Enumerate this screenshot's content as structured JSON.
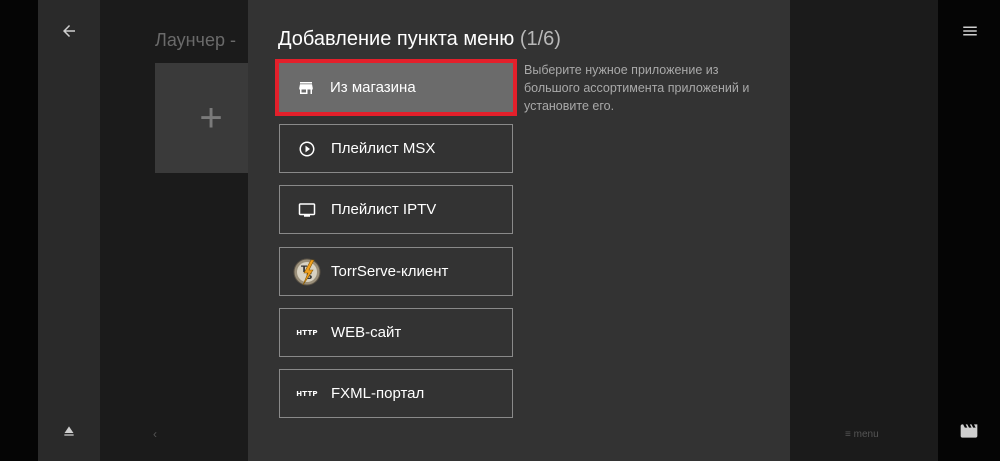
{
  "background": {
    "launcher_title": "Лаунчер -",
    "add_tile_symbol": "+",
    "page_prev_symbol": "‹",
    "menu_hint": "≡ menu"
  },
  "nav": {
    "back_icon": "arrow-left-icon",
    "menu_icon": "hamburger-icon",
    "eject_icon": "eject-icon",
    "clapper_icon": "clapperboard-icon"
  },
  "dialog": {
    "title": "Добавление пункта меню",
    "counter": "(1/6)",
    "hint": "Выберите нужное приложение из большого ассортимента приложений и установите его.",
    "items": [
      {
        "label": "Из магазина",
        "icon": "store-icon",
        "selected": true
      },
      {
        "label": "Плейлист MSX",
        "icon": "play-circle-icon",
        "selected": false
      },
      {
        "label": "Плейлист IPTV",
        "icon": "tv-icon",
        "selected": false
      },
      {
        "label": "TorrServe-клиент",
        "icon": "torrserve-logo-icon",
        "selected": false
      },
      {
        "label": "WEB-сайт",
        "icon": "http-icon",
        "icon_text": "HTTP",
        "selected": false
      },
      {
        "label": "FXML-портал",
        "icon": "http-icon",
        "icon_text": "HTTP",
        "selected": false
      }
    ]
  },
  "colors": {
    "selection_border": "#e3202b",
    "dialog_bg": "#333333",
    "selected_bg": "#6b6b6b"
  }
}
